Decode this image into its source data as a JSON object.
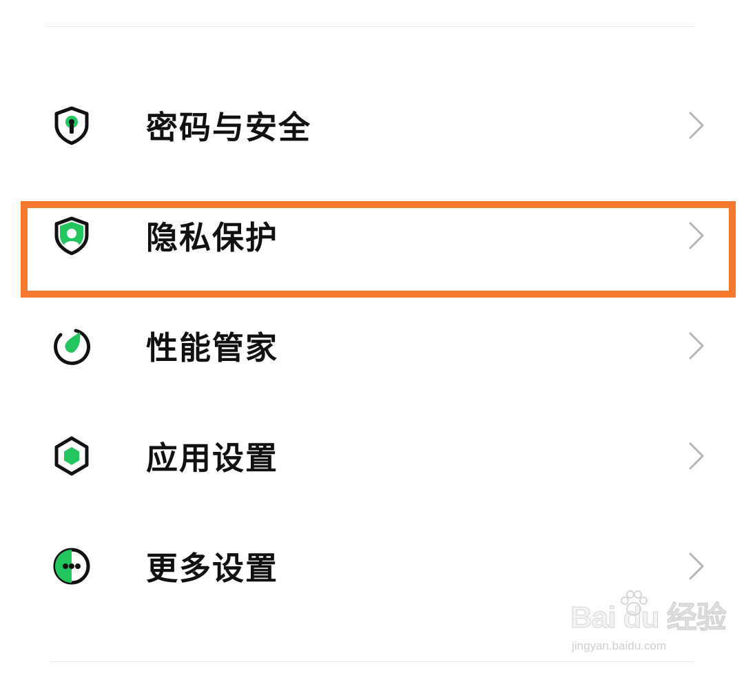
{
  "settings": {
    "items": [
      {
        "label": "密码与安全",
        "icon": "shield-keyhole-icon"
      },
      {
        "label": "隐私保护",
        "icon": "shield-person-icon",
        "highlighted": true
      },
      {
        "label": "性能管家",
        "icon": "performance-leaf-icon"
      },
      {
        "label": "应用设置",
        "icon": "hexagon-apps-icon"
      },
      {
        "label": "更多设置",
        "icon": "more-dots-icon"
      }
    ],
    "chevron_icon": "chevron-right-icon"
  },
  "colors": {
    "accent_green": "#22c55e",
    "icon_dark": "#111111",
    "highlight_orange": "#f5792c",
    "chevron_gray": "#b5b5b5"
  },
  "watermark": {
    "main": "Bai du 经验",
    "sub": "jingyan.baidu.com"
  }
}
